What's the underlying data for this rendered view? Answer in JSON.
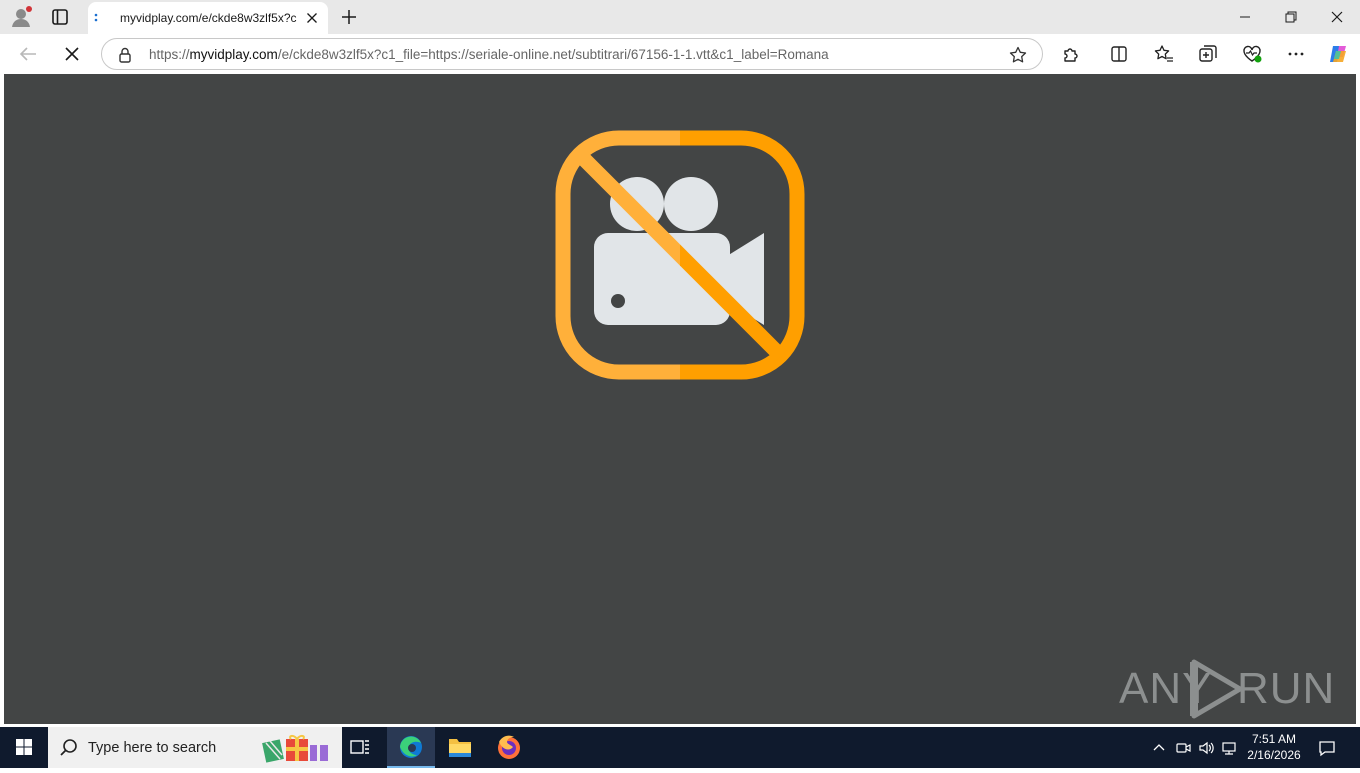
{
  "browser": {
    "tab": {
      "title": "myvidplay.com/e/ckde8w3zlf5x?c"
    },
    "address_bar": {
      "url_prefix": "https://",
      "url_host": "myvidplay.com",
      "url_rest": "/e/ckde8w3zlf5x?c1_file=https://seriale-online.net/subtitrari/67156-1-1.vtt&c1_label=Romana"
    },
    "icons": {
      "profile": "profile-icon",
      "tab_actions": "tab-actions-icon",
      "new_tab": "plus-icon",
      "back": "back-arrow-icon",
      "stop": "stop-loading-icon",
      "lock": "lock-icon",
      "favorite": "star-icon",
      "extensions": "puzzle-icon",
      "split_screen": "split-screen-icon",
      "favorites": "favorites-icon",
      "collections": "collections-icon",
      "browser_essentials": "heart-pulse-icon",
      "more": "more-icon",
      "copilot": "copilot-icon"
    },
    "colors": {
      "accent": "#0078d4"
    }
  },
  "page": {
    "background": "#434545",
    "icon": "no-video-icon",
    "icon_colors": {
      "left": "#ffb03a",
      "right": "#ff9f00",
      "camera": "#e1e5e8"
    },
    "watermark": {
      "text_left": "ANY",
      "text_right": "RUN"
    }
  },
  "taskbar": {
    "search_placeholder": "Type here to search",
    "apps": [
      "task-view-icon",
      "edge-icon",
      "file-explorer-icon",
      "firefox-icon"
    ],
    "clock": {
      "time": "7:51 AM",
      "date": "2/16/2026"
    }
  }
}
